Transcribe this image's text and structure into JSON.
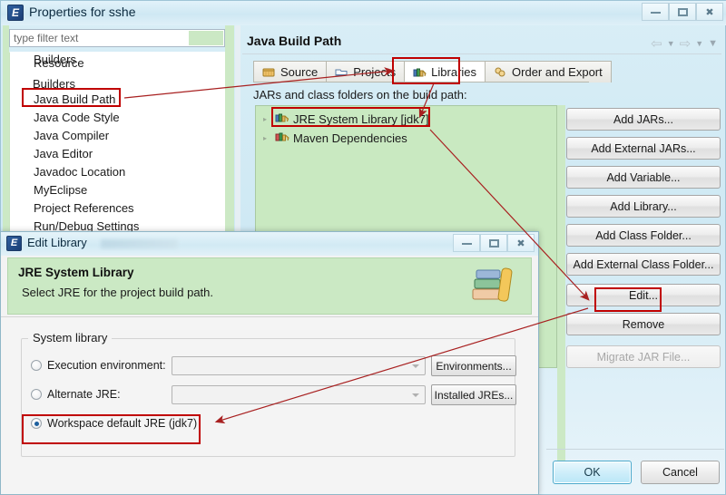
{
  "window": {
    "title": "Properties for sshe",
    "icon": "eclipse-icon",
    "controls": {
      "minimize": "minimize-icon",
      "maximize": "maximize-icon",
      "close": "close-icon"
    }
  },
  "filter": {
    "placeholder": "type filter text",
    "value": ""
  },
  "sidebar": {
    "items": [
      {
        "label": "Resource"
      },
      {
        "label": "Builders"
      },
      {
        "label": "Java Build Path",
        "highlighted": true
      },
      {
        "label": "Java Code Style"
      },
      {
        "label": "Java Compiler"
      },
      {
        "label": "Java Editor"
      },
      {
        "label": "Javadoc Location"
      },
      {
        "label": "MyEclipse"
      },
      {
        "label": "Project References"
      },
      {
        "label": "Run/Debug Settings"
      }
    ]
  },
  "page": {
    "title": "Java Build Path",
    "nav": {
      "back": "back-arrow-icon",
      "forward": "forward-arrow-icon",
      "menu": "chevron-down-icon"
    },
    "tabs": [
      {
        "label": "Source",
        "icon": "source-folder-icon",
        "selected": false
      },
      {
        "label": "Projects",
        "icon": "projects-icon",
        "selected": false
      },
      {
        "label": "Libraries",
        "icon": "libraries-icon",
        "selected": true
      },
      {
        "label": "Order and Export",
        "icon": "order-export-icon",
        "selected": false
      }
    ],
    "list_label": "JARs and class folders on the build path:",
    "tree": [
      {
        "label": "JRE System Library [jdk7]",
        "icon": "library-icon",
        "highlighted": true
      },
      {
        "label": "Maven Dependencies",
        "icon": "maven-library-icon",
        "highlighted": false
      }
    ],
    "buttons": [
      {
        "label": "Add JARs...",
        "enabled": true,
        "highlighted": false
      },
      {
        "label": "Add External JARs...",
        "enabled": true,
        "highlighted": false
      },
      {
        "label": "Add Variable...",
        "enabled": true,
        "highlighted": false
      },
      {
        "label": "Add Library...",
        "enabled": true,
        "highlighted": false
      },
      {
        "label": "Add Class Folder...",
        "enabled": true,
        "highlighted": false
      },
      {
        "label": "Add External Class Folder...",
        "enabled": true,
        "highlighted": false
      },
      {
        "label": "Edit...",
        "enabled": true,
        "highlighted": true
      },
      {
        "label": "Remove",
        "enabled": true,
        "highlighted": false
      },
      {
        "label": "Migrate JAR File...",
        "enabled": false,
        "highlighted": false
      }
    ],
    "footer": {
      "ok": "OK",
      "cancel": "Cancel"
    }
  },
  "edit_dialog": {
    "title": "Edit Library",
    "icon": "eclipse-icon",
    "controls": {
      "minimize": "minimize-icon",
      "maximize": "maximize-icon",
      "close": "close-icon"
    },
    "banner": {
      "heading": "JRE System Library",
      "subtext": "Select JRE for the project build path.",
      "icon": "books-icon"
    },
    "group_title": "System library",
    "options": [
      {
        "label": "Execution environment:",
        "selected": false,
        "combo_value": "",
        "button": "Environments..."
      },
      {
        "label": "Alternate JRE:",
        "selected": false,
        "combo_value": "",
        "button": "Installed JREs..."
      },
      {
        "label": "Workspace default JRE (jdk7)",
        "selected": true,
        "highlighted": true
      }
    ]
  },
  "annotations": {
    "color": "#c00000",
    "boxes": [
      "java-build-path-sidebar-item",
      "libraries-tab",
      "jre-system-library-tree-item",
      "edit-button",
      "workspace-default-jre-radio"
    ],
    "arrows": [
      "sidebar-to-libraries-tab",
      "libraries-tab-to-tree-item",
      "tree-item-to-edit-button",
      "edit-button-to-workspace-default-jre"
    ]
  }
}
